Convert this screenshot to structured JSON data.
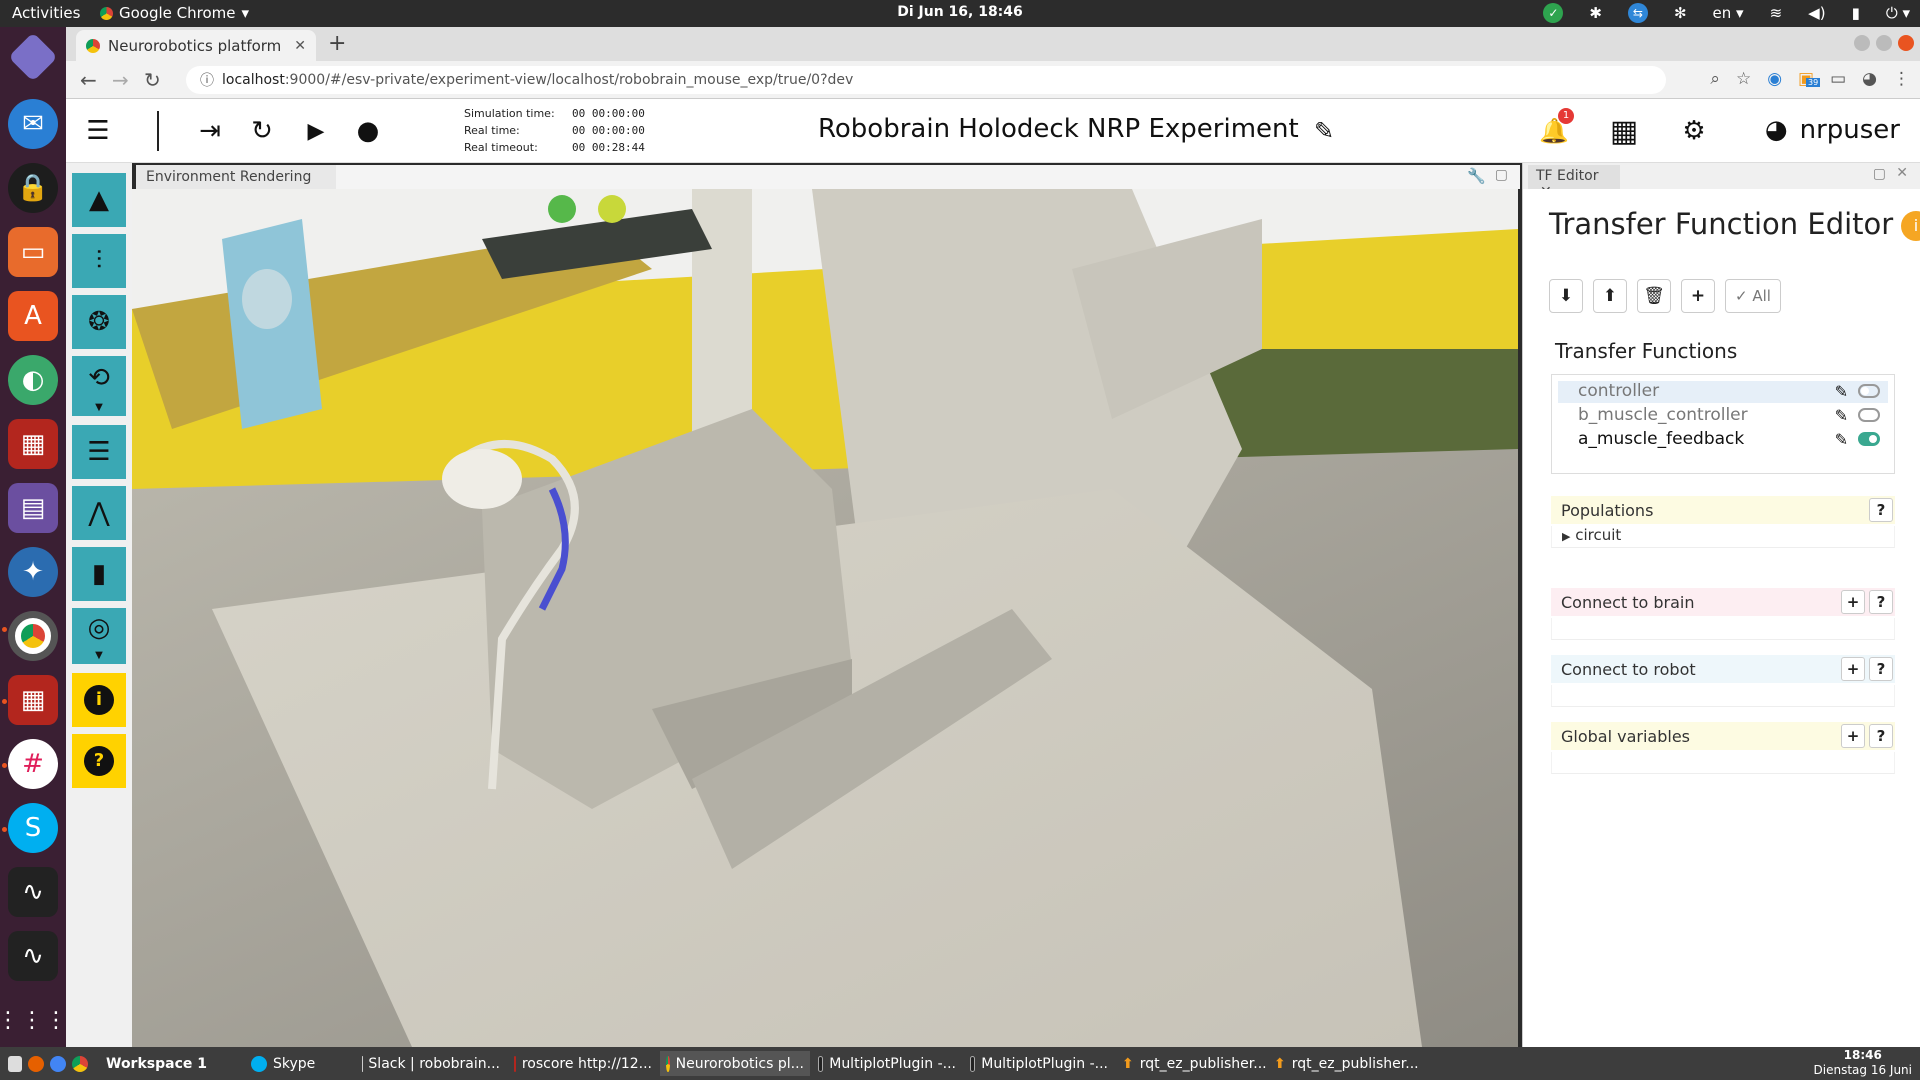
{
  "os": {
    "activities": "Activities",
    "app_menu": "Google Chrome",
    "clock": "Di Jun 16, 18:46",
    "lang": "en"
  },
  "browser": {
    "tab_title": "Neurorobotics platform",
    "url_host": "localhost",
    "url_rest": ":9000/#/esv-private/experiment-view/localhost/robobrain_mouse_exp/true/0?dev",
    "ext_badge": "39"
  },
  "header": {
    "sim_time_label": "Simulation time:",
    "sim_time": "00 00:00:00",
    "real_time_label": "Real time:",
    "real_time": "00 00:00:00",
    "real_timeout_label": "Real timeout:",
    "real_timeout": "00 00:28:44",
    "title": "Robobrain Holodeck NRP Experiment",
    "notif_count": "1",
    "user": "nrpuser"
  },
  "env": {
    "tab": "Environment Rendering"
  },
  "tf_editor": {
    "tab": "TF Editor",
    "title": "Transfer Function Editor",
    "all_label": "All",
    "section": "Transfer Functions",
    "functions": [
      {
        "name": "controller",
        "enabled": false
      },
      {
        "name": "b_muscle_controller",
        "enabled": false
      },
      {
        "name": "a_muscle_feedback",
        "enabled": true
      }
    ],
    "populations": "Populations",
    "population_items": [
      "circuit"
    ],
    "connect_brain": "Connect to brain",
    "connect_robot": "Connect to robot",
    "global_vars": "Global variables"
  },
  "taskbar": {
    "workspace": "Workspace 1",
    "items": [
      "Skype",
      "Slack | robobrain...",
      "roscore http://12...",
      "Neurorobotics pl...",
      "MultiplotPlugin -...",
      "MultiplotPlugin -...",
      "rqt_ez_publisher...",
      "rqt_ez_publisher..."
    ],
    "time": "18:46",
    "date": "Dienstag 16 Juni"
  },
  "colors": {
    "accent_teal": "#3aa8b4",
    "accent_yellow": "#ffd200",
    "ubuntu_orange": "#e95420"
  }
}
